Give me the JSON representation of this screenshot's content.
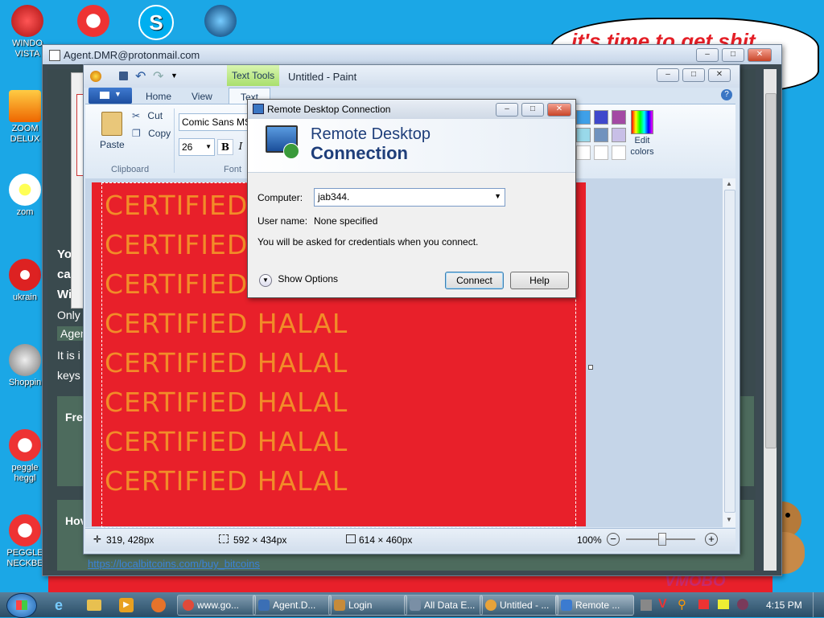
{
  "desktop": {
    "icons": [
      {
        "label": "WINDO\nVISTA"
      },
      {
        "label": "ZOOM\nDELUX"
      },
      {
        "label": "zom"
      },
      {
        "label": "ukrain"
      },
      {
        "label": "Shoppin"
      },
      {
        "label": "peggle\nheggl"
      },
      {
        "label": "PEGGLE\nNECKBE"
      }
    ],
    "banner_text": "it's time to get shit",
    "watermark": "VMOBO"
  },
  "browser": {
    "title": "Agent.DMR@protonmail.com",
    "lines": [
      "Yo",
      "ca",
      "Wi",
      "Only",
      "Agen",
      "It is i",
      "keys"
    ],
    "sections": [
      "Fre",
      "Hov"
    ],
    "link": "https://localbitcoins.com/buy_bitcoins"
  },
  "paint": {
    "title": "Untitled - Paint",
    "context_tab": "Text Tools",
    "tabs": [
      "Home",
      "View",
      "Text"
    ],
    "clipboard": {
      "paste": "Paste",
      "cut": "Cut",
      "copy": "Copy",
      "group": "Clipboard"
    },
    "font": {
      "name": "Comic Sans MS",
      "size": "26",
      "bold": "B",
      "italic": "I",
      "group": "Font"
    },
    "edit_colors": "Edit\ncolors",
    "canvas_lines": [
      "CERTIFIED",
      "CERTIFIED",
      "CERTIFIED",
      "CERTIFIED HALAL",
      "CERTIFIED HALAL",
      "CERTIFIED HALAL",
      "CERTIFIED HALAL",
      "CERTIFIED HALAL"
    ],
    "status": {
      "cursor": "319, 428px",
      "selection": "592 × 434px",
      "size": "614 × 460px",
      "zoom": "100%"
    },
    "colors": {
      "canvas": "#e8202a",
      "text": "#f28c28"
    }
  },
  "rdc": {
    "title": "Remote Desktop Connection",
    "header_line1": "Remote Desktop",
    "header_line2": "Connection",
    "computer_label": "Computer:",
    "computer_value": "jab344.",
    "username_label": "User name:",
    "username_value": "None specified",
    "note": "You will be asked for credentials when you connect.",
    "show_options": "Show Options",
    "connect": "Connect",
    "help": "Help"
  },
  "taskbar": {
    "items": [
      {
        "label": "www.go...",
        "color": "#e04a3a"
      },
      {
        "label": "Agent.D...",
        "color": "#3b6fb5"
      },
      {
        "label": "Login",
        "color": "#c78b3a"
      },
      {
        "label": "All Data E...",
        "color": "#7a8fa5"
      },
      {
        "label": "Untitled - ...",
        "color": "#e8a33a"
      },
      {
        "label": "Remote ...",
        "color": "#3b7bd0"
      }
    ],
    "clock": "4:15 PM"
  }
}
